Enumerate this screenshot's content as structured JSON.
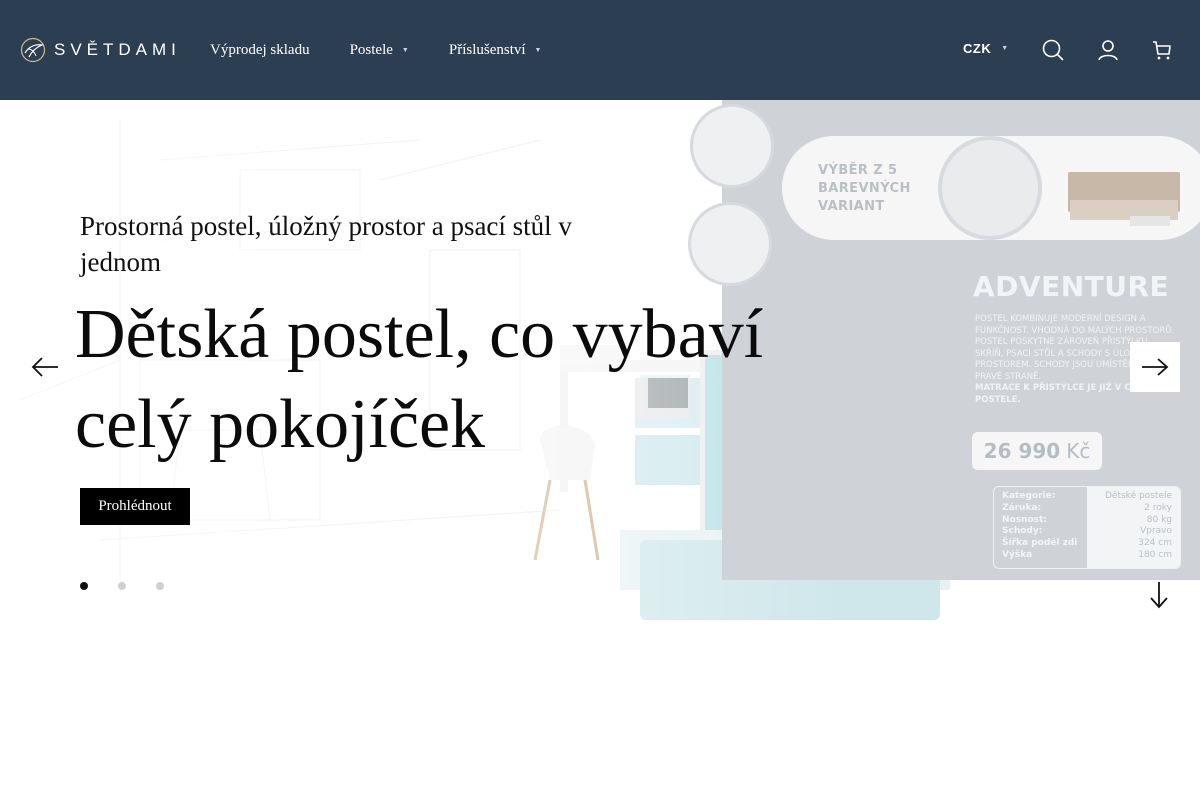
{
  "header": {
    "logo_text": "SVĚTDAMI",
    "nav": [
      {
        "label": "Výprodej skladu",
        "has_dropdown": false
      },
      {
        "label": "Postele",
        "has_dropdown": true
      },
      {
        "label": "Příslušenství",
        "has_dropdown": true
      }
    ],
    "currency": "CZK",
    "icons": [
      "search-icon",
      "user-icon",
      "cart-icon"
    ],
    "background": "#2c3e52"
  },
  "hero": {
    "subtitle": "Prostorná postel, úložný prostor a psací stůl v jednom",
    "title": "Dětská postel, co vybaví celý pokojíček",
    "button_label": "Prohlédnout",
    "slides_total": 3,
    "active_slide": 1
  },
  "promo": {
    "variants_text": "VÝBĚR Z 5 BAREVNÝCH VARIANT",
    "product_name": "ADVENTURE",
    "description": "POSTEL KOMBINUJE MODERNÍ DESIGN A FUNKČNOST. VHODNÁ DO MALÝCH PROSTORŮ. POSTEL POSKYTNE ZÁROVEŇ PŘISTÝLKU, SKŘÍŇ, PSACÍ STŮL A SCHODY S ÚLOŽNÝM PROSTOREM. SCHODY JSOU UMÍSTĚNY NA PRAVÉ STRANĚ.",
    "description_strong": "MATRACE K PŘISTÝLCE JE JIŽ V CENĚ POSTELE.",
    "price": "26 990",
    "price_currency": "Kč",
    "specs": [
      {
        "key": "Kategorie:",
        "value": "Dětské postele"
      },
      {
        "key": "Záruka:",
        "value": "2 roky"
      },
      {
        "key": "Nosnost:",
        "value": "80 kg"
      },
      {
        "key": "Schody:",
        "value": "Vpravo"
      },
      {
        "key": "Šířka podél zdi",
        "value": "324 cm"
      },
      {
        "key": "Výška",
        "value": "180 cm"
      }
    ]
  }
}
